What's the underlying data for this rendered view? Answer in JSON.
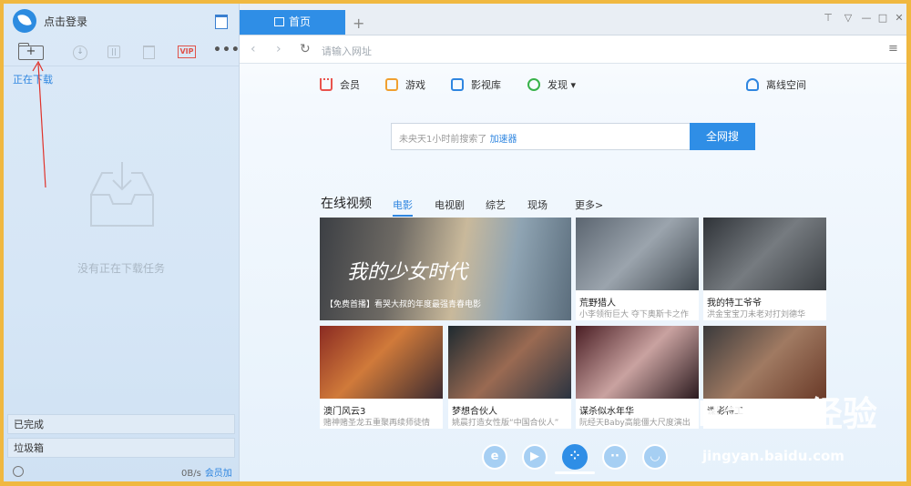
{
  "left": {
    "login_label": "点击登录",
    "downloading_label": "正在下载",
    "empty_text": "没有正在下载任务",
    "toolbar": {
      "new_label": "+",
      "vip_label": "VIP",
      "more_label": "•••"
    },
    "categories": [
      "已完成",
      "垃圾箱"
    ],
    "speed": "0B/s",
    "boost_label": "会员加速"
  },
  "browser": {
    "tab_label": "首页",
    "add_tab": "+",
    "url_placeholder": "请输入网址",
    "window_controls": [
      "shirt-icon",
      "dropdown-icon",
      "minimize-icon",
      "maximize-icon",
      "close-icon"
    ]
  },
  "quick_links": [
    {
      "label": "会员",
      "icon": "crown-icon",
      "color": "#e9534d"
    },
    {
      "label": "游戏",
      "icon": "game-icon",
      "color": "#f0a030"
    },
    {
      "label": "影视库",
      "icon": "film-icon",
      "color": "#2f86e0"
    },
    {
      "label": "发现 ▾",
      "icon": "discover-icon",
      "color": "#38b24a"
    },
    {
      "label": "离线空间",
      "icon": "cloud-icon",
      "color": "#2f86e0"
    }
  ],
  "search": {
    "placeholder_prefix": "未央天1小时前搜索了",
    "placeholder_highlight": "加速器",
    "button_label": "全网搜"
  },
  "video_section": {
    "title": "在线视频",
    "tabs": [
      "电影",
      "电视剧",
      "综艺",
      "现场",
      "更多>"
    ],
    "featured": {
      "title_art": "我的少女时代",
      "caption": "【免费首播】看哭大叔的年度最强青春电影"
    },
    "tiles": [
      {
        "title": "荒野猎人",
        "subtitle": "小李领衔巨大 夺下奥斯卡之作"
      },
      {
        "title": "我的特工爷爷",
        "subtitle": "洪金宝宝刀未老对打刘德华"
      },
      {
        "title": "澳门风云3",
        "subtitle": "赌神赌圣龙五重聚再续师徒情"
      },
      {
        "title": "梦想合伙人",
        "subtitle": "姚晨打造女性版“中国合伙人”"
      },
      {
        "title": "谋杀似水年华",
        "subtitle": "阮经天Baby高能僵大尺度演出"
      },
      {
        "title": "谍影特工",
        "subtitle": ""
      }
    ]
  },
  "dock": [
    "e",
    "▶",
    "⁘",
    "··",
    "◡"
  ],
  "watermark": {
    "text": "Baidu经验",
    "url": "jingyan.baidu.com"
  }
}
